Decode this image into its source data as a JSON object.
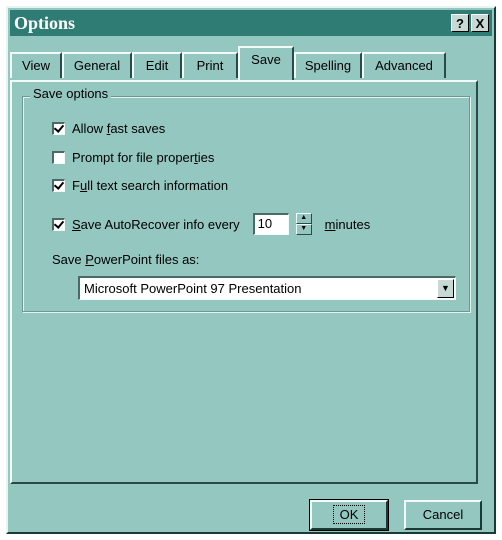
{
  "window": {
    "title": "Options",
    "help_label": "?",
    "close_label": "X"
  },
  "tabs": [
    {
      "label": "View"
    },
    {
      "label": "General"
    },
    {
      "label": "Edit"
    },
    {
      "label": "Print"
    },
    {
      "label": "Save",
      "active": true
    },
    {
      "label": "Spelling"
    },
    {
      "label": "Advanced"
    }
  ],
  "save_options": {
    "group_label": "Save options",
    "allow_fast_saves": {
      "pre": "Allow ",
      "key": "f",
      "post": "ast saves",
      "checked": true
    },
    "prompt_file_properties": {
      "pre": "Prompt for file proper",
      "key": "t",
      "post": "ies",
      "checked": false
    },
    "full_text_search": {
      "pre": "F",
      "key": "u",
      "post": "ll text search information",
      "checked": true
    },
    "autorecover": {
      "key": "S",
      "post": "ave AutoRecover info every",
      "checked": true,
      "value": "10",
      "unit_key": "m",
      "unit_post": "inutes"
    },
    "save_as": {
      "pre": "Save ",
      "key": "P",
      "post": "owerPoint files as:",
      "selected": "Microsoft PowerPoint 97 Presentation"
    }
  },
  "buttons": {
    "ok_label": "OK",
    "cancel_label": "Cancel"
  }
}
